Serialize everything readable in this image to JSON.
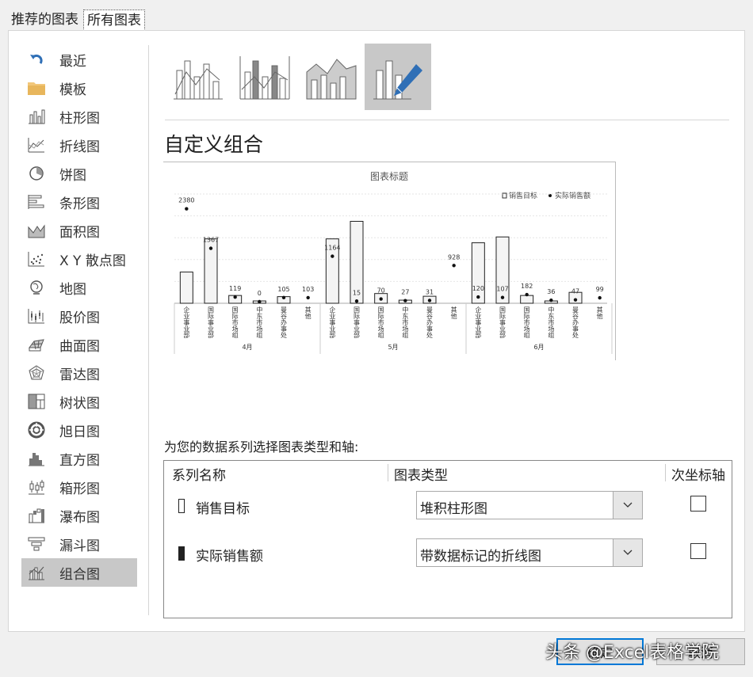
{
  "tabs": [
    {
      "label": "推荐的图表"
    },
    {
      "label": "所有图表"
    }
  ],
  "sidebar": {
    "items": [
      {
        "label": "最近",
        "icon": "undo-arrow-icon"
      },
      {
        "label": "模板",
        "icon": "folder-icon"
      },
      {
        "label": "柱形图",
        "icon": "column-chart-icon"
      },
      {
        "label": "折线图",
        "icon": "line-chart-icon"
      },
      {
        "label": "饼图",
        "icon": "pie-chart-icon"
      },
      {
        "label": "条形图",
        "icon": "bar-chart-icon"
      },
      {
        "label": "面积图",
        "icon": "area-chart-icon"
      },
      {
        "label": "X Y 散点图",
        "icon": "scatter-chart-icon"
      },
      {
        "label": "地图",
        "icon": "globe-icon"
      },
      {
        "label": "股价图",
        "icon": "stock-chart-icon"
      },
      {
        "label": "曲面图",
        "icon": "surface-chart-icon"
      },
      {
        "label": "雷达图",
        "icon": "radar-chart-icon"
      },
      {
        "label": "树状图",
        "icon": "treemap-icon"
      },
      {
        "label": "旭日图",
        "icon": "sunburst-icon"
      },
      {
        "label": "直方图",
        "icon": "histogram-icon"
      },
      {
        "label": "箱形图",
        "icon": "box-whisker-icon"
      },
      {
        "label": "瀑布图",
        "icon": "waterfall-icon"
      },
      {
        "label": "漏斗图",
        "icon": "funnel-icon"
      },
      {
        "label": "组合图",
        "icon": "combo-chart-icon"
      }
    ],
    "selected_index": 18
  },
  "chart_types": {
    "selected_index": 3,
    "title": "自定义组合"
  },
  "preview": {
    "chart_data": {
      "type": "bar",
      "title": "图表标题",
      "legend_position": "top-right",
      "groups": [
        "4月",
        "5月",
        "6月"
      ],
      "categories": [
        "企业事业部",
        "国际事业部",
        "国际市场组",
        "中东市场组",
        "曼谷办事处",
        "其他",
        "企业事业部",
        "国际事业部",
        "国际市场组",
        "中东市场组",
        "曼谷办事处",
        "其他",
        "企业事业部",
        "国际事业部",
        "国际市场组",
        "中东市场组",
        "曼谷办事处"
      ],
      "series": [
        {
          "name": "销售目标",
          "type": "bar",
          "values": [
            800,
            1650,
            200,
            60,
            170,
            0,
            1650,
            2100,
            250,
            80,
            180,
            0,
            1550,
            1700,
            200,
            60,
            280
          ]
        },
        {
          "name": "实际销售额",
          "type": "line-markers",
          "values": [
            2380,
            1367,
            119,
            0,
            105,
            103,
            1164,
            15,
            70,
            27,
            31,
            928,
            120,
            107,
            182,
            36,
            47,
            99
          ]
        }
      ],
      "data_labels": [
        "2380",
        "1367",
        "119",
        "0",
        "105",
        "103",
        "1164",
        "15",
        "70",
        "27",
        "31",
        "928",
        "120",
        "107",
        "182",
        "36",
        "47",
        "99"
      ],
      "grid": true
    }
  },
  "series_section": {
    "label": "为您的数据系列选择图表类型和轴:",
    "headers": {
      "name": "系列名称",
      "type": "图表类型",
      "secondary": "次坐标轴"
    },
    "rows": [
      {
        "name": "销售目标",
        "chart_type": "堆积柱形图",
        "secondary_axis": false
      },
      {
        "name": "实际销售额",
        "chart_type": "带数据标记的折线图",
        "secondary_axis": false
      }
    ]
  },
  "buttons": {
    "ok": "确定",
    "cancel": "取消"
  },
  "watermark": "头条 @Excel表格学院"
}
